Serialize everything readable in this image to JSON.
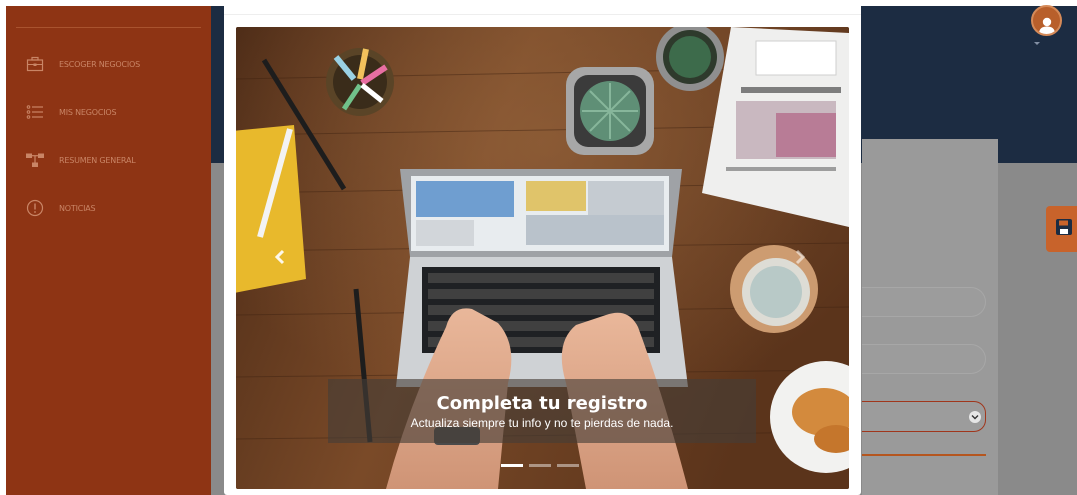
{
  "sidebar": {
    "items": [
      {
        "label": "ESCOGER NEGOCIOS",
        "icon": "briefcase-icon"
      },
      {
        "label": "MIS NEGOCIOS",
        "icon": "list-icon"
      },
      {
        "label": "RESUMEN GENERAL",
        "icon": "hierarchy-icon"
      },
      {
        "label": "NOTICIAS",
        "icon": "info-circle-icon"
      }
    ]
  },
  "header": {
    "avatar_icon": "user-avatar-icon"
  },
  "carousel": {
    "slide_title": "Completa tu registro",
    "slide_text": "Actualiza siempre tu info y no te pierdas de nada.",
    "prev_icon": "chevron-left-icon",
    "next_icon": "chevron-right-icon",
    "slide_count": 3,
    "active_slide": 1
  },
  "colors": {
    "sidebar": "#8e3414",
    "topbar": "#1c2c42",
    "accent": "#c8632b",
    "overlay": "#8a8a8a"
  }
}
